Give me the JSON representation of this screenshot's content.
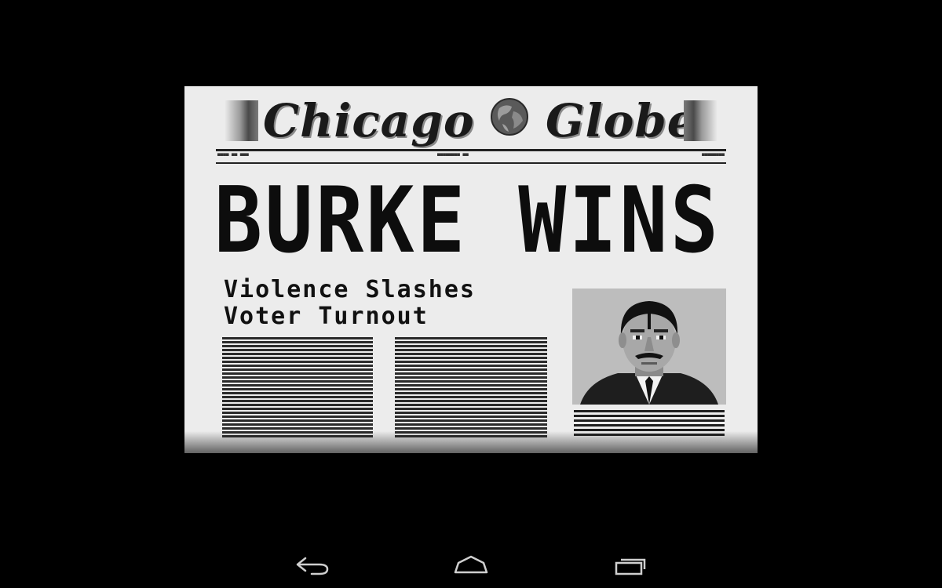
{
  "newspaper": {
    "masthead_left": "Chicago",
    "masthead_right": "Globe",
    "masthead_icon": "globe-icon",
    "headline": "BURKE WINS",
    "subhead_line1": "Violence Slashes",
    "subhead_line2": "Voter Turnout",
    "photo_subject": "portrait of a man with a moustache in a dark suit"
  },
  "navbar": {
    "back_icon": "back-icon",
    "home_icon": "home-icon",
    "recents_icon": "recents-icon"
  },
  "colors": {
    "screen_background": "#000000",
    "paper": "#ececec",
    "ink": "#111111",
    "photo_background": "#bdbdbd"
  }
}
